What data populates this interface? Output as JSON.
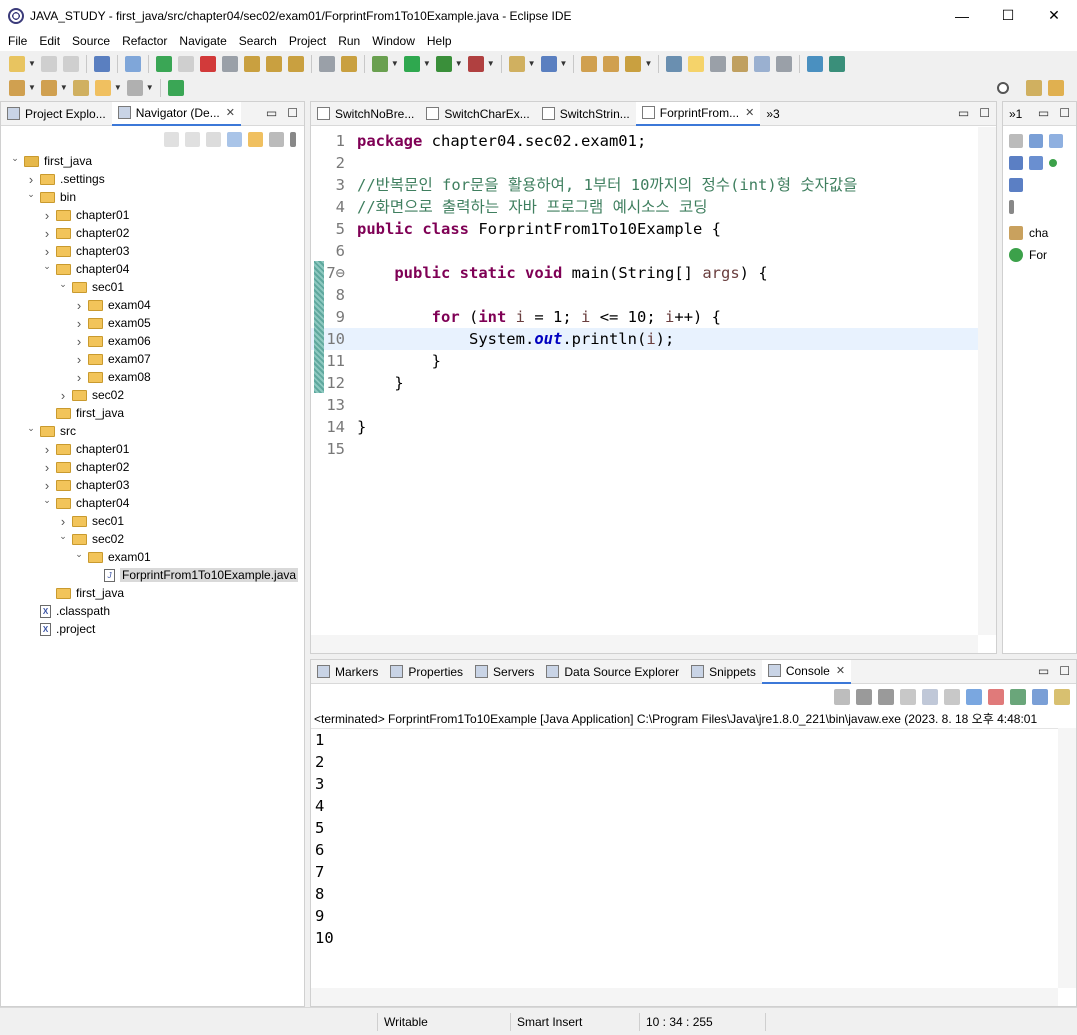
{
  "window": {
    "title": "JAVA_STUDY - first_java/src/chapter04/sec02/exam01/ForprintFrom1To10Example.java - Eclipse IDE",
    "controls": [
      "—",
      "☐",
      "✕"
    ]
  },
  "menu": [
    "File",
    "Edit",
    "Source",
    "Refactor",
    "Navigate",
    "Search",
    "Project",
    "Run",
    "Window",
    "Help"
  ],
  "left_tabs": [
    {
      "label": "Project Explo...",
      "active": false
    },
    {
      "label": "Navigator (De...",
      "active": true
    }
  ],
  "tree": [
    {
      "label": "first_java",
      "depth": 0,
      "type": "project",
      "expanded": true
    },
    {
      "label": ".settings",
      "depth": 1,
      "type": "folder",
      "expanded": false
    },
    {
      "label": "bin",
      "depth": 1,
      "type": "folder",
      "expanded": true
    },
    {
      "label": "chapter01",
      "depth": 2,
      "type": "folder",
      "expanded": false
    },
    {
      "label": "chapter02",
      "depth": 2,
      "type": "folder",
      "expanded": false
    },
    {
      "label": "chapter03",
      "depth": 2,
      "type": "folder",
      "expanded": false
    },
    {
      "label": "chapter04",
      "depth": 2,
      "type": "folder",
      "expanded": true
    },
    {
      "label": "sec01",
      "depth": 3,
      "type": "folder",
      "expanded": true
    },
    {
      "label": "exam04",
      "depth": 4,
      "type": "folder",
      "expanded": false
    },
    {
      "label": "exam05",
      "depth": 4,
      "type": "folder",
      "expanded": false
    },
    {
      "label": "exam06",
      "depth": 4,
      "type": "folder",
      "expanded": false
    },
    {
      "label": "exam07",
      "depth": 4,
      "type": "folder",
      "expanded": false
    },
    {
      "label": "exam08",
      "depth": 4,
      "type": "folder",
      "expanded": false
    },
    {
      "label": "sec02",
      "depth": 3,
      "type": "folder",
      "expanded": false
    },
    {
      "label": "first_java",
      "depth": 2,
      "type": "folder",
      "leaf": true
    },
    {
      "label": "src",
      "depth": 1,
      "type": "folder",
      "expanded": true
    },
    {
      "label": "chapter01",
      "depth": 2,
      "type": "folder",
      "expanded": false
    },
    {
      "label": "chapter02",
      "depth": 2,
      "type": "folder",
      "expanded": false
    },
    {
      "label": "chapter03",
      "depth": 2,
      "type": "folder",
      "expanded": false
    },
    {
      "label": "chapter04",
      "depth": 2,
      "type": "folder",
      "expanded": true
    },
    {
      "label": "sec01",
      "depth": 3,
      "type": "folder",
      "expanded": false
    },
    {
      "label": "sec02",
      "depth": 3,
      "type": "folder",
      "expanded": true
    },
    {
      "label": "exam01",
      "depth": 4,
      "type": "folder",
      "expanded": true
    },
    {
      "label": "ForprintFrom1To10Example.java",
      "depth": 5,
      "type": "java",
      "leaf": true,
      "selected": true
    },
    {
      "label": "first_java",
      "depth": 2,
      "type": "folder",
      "leaf": true
    },
    {
      "label": ".classpath",
      "depth": 1,
      "type": "xml",
      "leaf": true
    },
    {
      "label": ".project",
      "depth": 1,
      "type": "xml",
      "leaf": true
    }
  ],
  "editor_tabs": [
    {
      "label": "SwitchNoBre...",
      "active": false
    },
    {
      "label": "SwitchCharEx...",
      "active": false
    },
    {
      "label": "SwitchStrin...",
      "active": false
    },
    {
      "label": "ForprintFrom...",
      "active": true
    }
  ],
  "editor_overflow": "»3",
  "code_lines": [
    {
      "n": "1",
      "html": "<span class=\"kw\">package</span> chapter04.sec02.exam01;"
    },
    {
      "n": "2",
      "html": ""
    },
    {
      "n": "3",
      "html": "<span class=\"cm\">//반복문인 for문을 활용하여, 1부터 10까지의 정수(int)형 숫자값을</span>"
    },
    {
      "n": "4",
      "html": "<span class=\"cm\">//화면으로 출력하는 자바 프로그램 예시소스 코딩</span>"
    },
    {
      "n": "5",
      "html": "<span class=\"kw\">public</span> <span class=\"kw\">class</span> ForprintFrom1To10Example {"
    },
    {
      "n": "6",
      "html": ""
    },
    {
      "n": "7⊖",
      "html": "    <span class=\"kw\">public</span> <span class=\"kw\">static</span> <span class=\"kw\">void</span> main(String[] <span class=\"vr\">args</span>) {"
    },
    {
      "n": "8",
      "html": ""
    },
    {
      "n": "9",
      "html": "        <span class=\"kw\">for</span> (<span class=\"kw\">int</span> <span class=\"vr\">i</span> = 1; <span class=\"vr\">i</span> &lt;= 10; <span class=\"vr\">i</span>++) {"
    },
    {
      "n": "10",
      "html": "            System.<span class=\"it\">out</span>.println(<span class=\"vr\">i</span>);",
      "current": true
    },
    {
      "n": "11",
      "html": "        }"
    },
    {
      "n": "12",
      "html": "    }"
    },
    {
      "n": "13",
      "html": ""
    },
    {
      "n": "14",
      "html": "}"
    },
    {
      "n": "15",
      "html": ""
    }
  ],
  "outline": {
    "items": [
      "cha",
      "For"
    ]
  },
  "console_tabs": [
    {
      "label": "Markers",
      "active": false
    },
    {
      "label": "Properties",
      "active": false
    },
    {
      "label": "Servers",
      "active": false
    },
    {
      "label": "Data Source Explorer",
      "active": false
    },
    {
      "label": "Snippets",
      "active": false
    },
    {
      "label": "Console",
      "active": true
    }
  ],
  "console": {
    "status": "<terminated> ForprintFrom1To10Example [Java Application] C:\\Program Files\\Java\\jre1.8.0_221\\bin\\javaw.exe  (2023. 8. 18 오후 4:48:01",
    "output": [
      "1",
      "2",
      "3",
      "4",
      "5",
      "6",
      "7",
      "8",
      "9",
      "10"
    ]
  },
  "statusbar": {
    "mode": "Writable",
    "insert": "Smart Insert",
    "position": "10 : 34 : 255"
  },
  "colors": {
    "keyword": "#7f0055",
    "comment": "#3f7f5f",
    "current_line": "#e8f2fe",
    "folder": "#f2c45a"
  }
}
